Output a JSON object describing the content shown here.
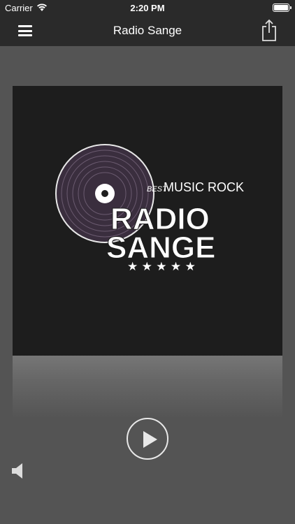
{
  "status_bar": {
    "carrier": "Carrier",
    "time": "2:20 PM"
  },
  "nav": {
    "title": "Radio Sange",
    "menu_icon": "hamburger-menu-icon",
    "share_icon": "share-icon"
  },
  "artwork": {
    "tagline_small": "BEST",
    "tagline": "MUSIC ROCK",
    "brand_line1": "RADIO",
    "brand_line2": "SANGE",
    "stars": "★ ★ ★ ★ ★"
  },
  "player": {
    "play_icon": "play-icon",
    "volume_icon": "speaker-icon"
  },
  "colors": {
    "background": "#545454",
    "bar": "#2a2a2a",
    "artwork_bg": "#1d1d1d",
    "record": "#3a2e3e"
  }
}
